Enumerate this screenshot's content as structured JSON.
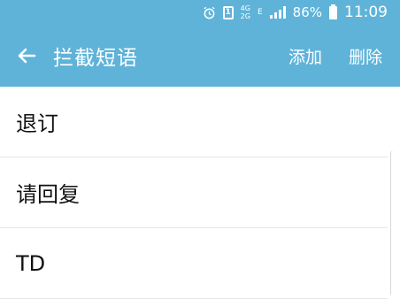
{
  "status_bar": {
    "sim_label": "1",
    "network_top": "4G",
    "network_bottom": "2G",
    "edge_label": "E",
    "battery_percent": "86%",
    "time": "11:09"
  },
  "toolbar": {
    "title": "拦截短语",
    "add_label": "添加",
    "delete_label": "删除"
  },
  "phrases": [
    {
      "text": "退订"
    },
    {
      "text": "请回复"
    },
    {
      "text": "TD"
    }
  ],
  "colors": {
    "accent": "#5fb3d9"
  }
}
